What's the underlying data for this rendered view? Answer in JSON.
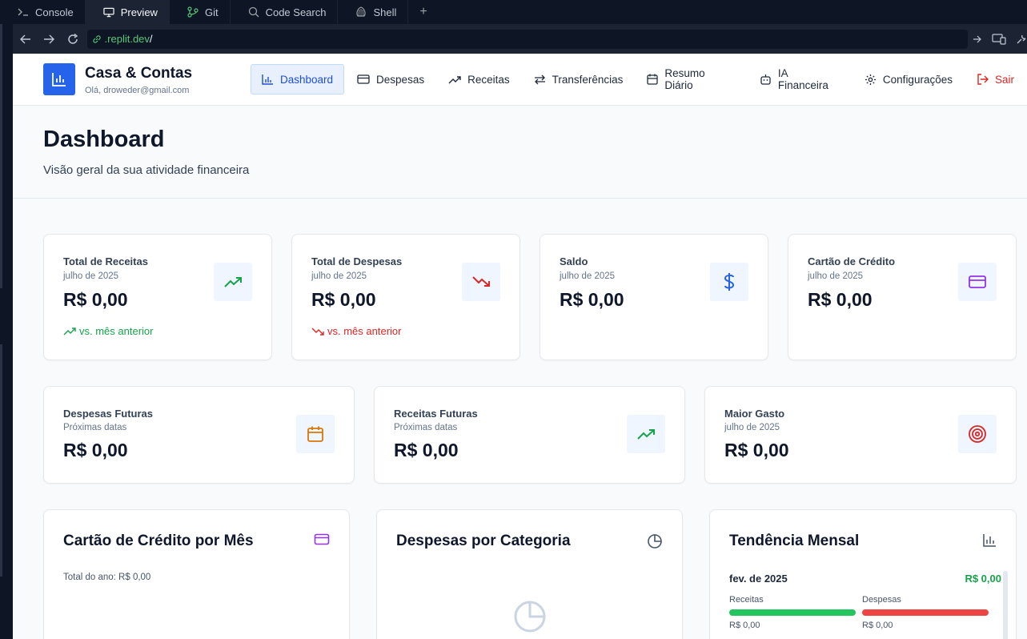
{
  "ide": {
    "tabs": [
      {
        "label": "Console",
        "icon": "terminal-icon"
      },
      {
        "label": "Preview",
        "icon": "monitor-icon",
        "active": true
      },
      {
        "label": "Git",
        "icon": "git-icon"
      },
      {
        "label": "Code Search",
        "icon": "search-icon"
      },
      {
        "label": "Shell",
        "icon": "shell-icon"
      }
    ],
    "new_tab": "+",
    "url_host": ".replit.dev",
    "url_path": "/"
  },
  "brand": {
    "name": "Casa & Contas",
    "user": "Olá, droweder@gmail.com"
  },
  "nav": {
    "dashboard": "Dashboard",
    "despesas": "Despesas",
    "receitas": "Receitas",
    "transferencias": "Transferências",
    "resumo": "Resumo Diário",
    "ia": "IA Financeira",
    "config": "Configurações",
    "sair": "Sair"
  },
  "page": {
    "title": "Dashboard",
    "subtitle": "Visão geral da sua atividade financeira"
  },
  "stats_row1": [
    {
      "title": "Total de Receitas",
      "sub": "julho de 2025",
      "value": "R$ 0,00",
      "trend": "vs. mês anterior",
      "icon": "trending-up-icon"
    },
    {
      "title": "Total de Despesas",
      "sub": "julho de 2025",
      "value": "R$ 0,00",
      "trend": "vs. mês anterior",
      "icon": "trending-down-icon"
    },
    {
      "title": "Saldo",
      "sub": "julho de 2025",
      "value": "R$ 0,00",
      "icon": "dollar-icon"
    },
    {
      "title": "Cartão de Crédito",
      "sub": "julho de 2025",
      "value": "R$ 0,00",
      "icon": "credit-card-icon"
    }
  ],
  "stats_row2": [
    {
      "title": "Despesas Futuras",
      "sub": "Próximas datas",
      "value": "R$ 0,00",
      "icon": "calendar-icon"
    },
    {
      "title": "Receitas Futuras",
      "sub": "Próximas datas",
      "value": "R$ 0,00",
      "icon": "trending-up-icon"
    },
    {
      "title": "Maior Gasto",
      "sub": "julho de 2025",
      "value": "R$ 0,00",
      "icon": "target-icon"
    }
  ],
  "panels": {
    "credit": {
      "title": "Cartão de Crédito por Mês",
      "note": "Total do ano: R$ 0,00"
    },
    "category": {
      "title": "Despesas por Categoria"
    },
    "trend": {
      "title": "Tendência Mensal",
      "month": "fev. de 2025",
      "net": "R$ 0,00",
      "income_label": "Receitas",
      "income_value": "R$ 0,00",
      "expense_label": "Despesas",
      "expense_value": "R$ 0,00"
    }
  },
  "colors": {
    "primary": "#2563eb",
    "income": "#16a34a",
    "expense": "#dc2626",
    "credit": "#9333ea",
    "calendar": "#d97706",
    "income_bar": "#22c55e",
    "expense_bar": "#ef4444"
  }
}
